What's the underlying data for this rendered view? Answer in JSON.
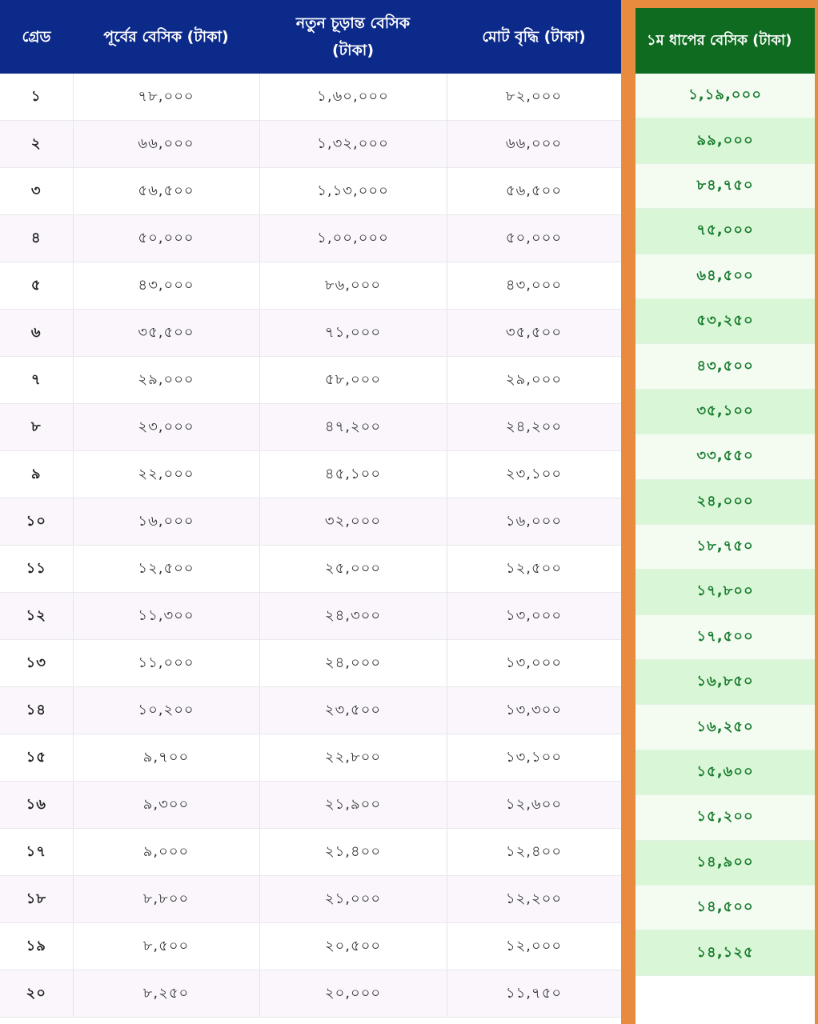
{
  "table": {
    "headers": {
      "grade": "গ্রেড",
      "previous_basic": "পূর্বের বেসিক (টাকা)",
      "new_final_basic_line1": "নতুন চূড়ান্ত বেসিক",
      "new_final_basic_line2": "(টাকা)",
      "total_increase": "মোট বৃদ্ধি (টাকা)",
      "first_phase_basic": "১ম ধাপের বেসিক (টাকা)"
    },
    "rows": [
      {
        "grade": "১",
        "previous_basic": "৭৮,০০০",
        "new_final_basic": "১,৬০,০০০",
        "total_increase": "৮২,০০০",
        "first_phase_basic": "১,১৯,০০০"
      },
      {
        "grade": "২",
        "previous_basic": "৬৬,০০০",
        "new_final_basic": "১,৩২,০০০",
        "total_increase": "৬৬,০০০",
        "first_phase_basic": "৯৯,০০০"
      },
      {
        "grade": "৩",
        "previous_basic": "৫৬,৫০০",
        "new_final_basic": "১,১৩,০০০",
        "total_increase": "৫৬,৫০০",
        "first_phase_basic": "৮৪,৭৫০"
      },
      {
        "grade": "৪",
        "previous_basic": "৫০,০০০",
        "new_final_basic": "১,০০,০০০",
        "total_increase": "৫০,০০০",
        "first_phase_basic": "৭৫,০০০"
      },
      {
        "grade": "৫",
        "previous_basic": "৪৩,০০০",
        "new_final_basic": "৮৬,০০০",
        "total_increase": "৪৩,০০০",
        "first_phase_basic": "৬৪,৫০০"
      },
      {
        "grade": "৬",
        "previous_basic": "৩৫,৫০০",
        "new_final_basic": "৭১,০০০",
        "total_increase": "৩৫,৫০০",
        "first_phase_basic": "৫৩,২৫০"
      },
      {
        "grade": "৭",
        "previous_basic": "২৯,০০০",
        "new_final_basic": "৫৮,০০০",
        "total_increase": "২৯,০০০",
        "first_phase_basic": "৪৩,৫০০"
      },
      {
        "grade": "৮",
        "previous_basic": "২৩,০০০",
        "new_final_basic": "৪৭,২০০",
        "total_increase": "২৪,২০০",
        "first_phase_basic": "৩৫,১০০"
      },
      {
        "grade": "৯",
        "previous_basic": "২২,০০০",
        "new_final_basic": "৪৫,১০০",
        "total_increase": "২৩,১০০",
        "first_phase_basic": "৩৩,৫৫০"
      },
      {
        "grade": "১০",
        "previous_basic": "১৬,০০০",
        "new_final_basic": "৩২,০০০",
        "total_increase": "১৬,০০০",
        "first_phase_basic": "২৪,০০০"
      },
      {
        "grade": "১১",
        "previous_basic": "১২,৫০০",
        "new_final_basic": "২৫,০০০",
        "total_increase": "১২,৫০০",
        "first_phase_basic": "১৮,৭৫০"
      },
      {
        "grade": "১২",
        "previous_basic": "১১,৩০০",
        "new_final_basic": "২৪,৩০০",
        "total_increase": "১৩,০০০",
        "first_phase_basic": "১৭,৮০০"
      },
      {
        "grade": "১৩",
        "previous_basic": "১১,০০০",
        "new_final_basic": "২৪,০০০",
        "total_increase": "১৩,০০০",
        "first_phase_basic": "১৭,৫০০"
      },
      {
        "grade": "১৪",
        "previous_basic": "১০,২০০",
        "new_final_basic": "২৩,৫০০",
        "total_increase": "১৩,৩০০",
        "first_phase_basic": "১৬,৮৫০"
      },
      {
        "grade": "১৫",
        "previous_basic": "৯,৭০০",
        "new_final_basic": "২২,৮০০",
        "total_increase": "১৩,১০০",
        "first_phase_basic": "১৬,২৫০"
      },
      {
        "grade": "১৬",
        "previous_basic": "৯,৩০০",
        "new_final_basic": "২১,৯০০",
        "total_increase": "১২,৬০০",
        "first_phase_basic": "১৫,৬০০"
      },
      {
        "grade": "১৭",
        "previous_basic": "৯,০০০",
        "new_final_basic": "২১,৪০০",
        "total_increase": "১২,৪০০",
        "first_phase_basic": "১৫,২০০"
      },
      {
        "grade": "১৮",
        "previous_basic": "৮,৮০০",
        "new_final_basic": "২১,০০০",
        "total_increase": "১২,২০০",
        "first_phase_basic": "১৪,৯০০"
      },
      {
        "grade": "১৯",
        "previous_basic": "৮,৫০০",
        "new_final_basic": "২০,৫০০",
        "total_increase": "১২,০০০",
        "first_phase_basic": "১৪,৫০০"
      },
      {
        "grade": "২০",
        "previous_basic": "৮,২৫০",
        "new_final_basic": "২০,০০০",
        "total_increase": "১১,৭৫০",
        "first_phase_basic": "১৪,১২৫"
      }
    ]
  },
  "colors": {
    "header_blue": "#0c2a8a",
    "header_green": "#0e6b1f",
    "highlight_orange": "#e88b3e",
    "green_text": "#167a2c"
  }
}
